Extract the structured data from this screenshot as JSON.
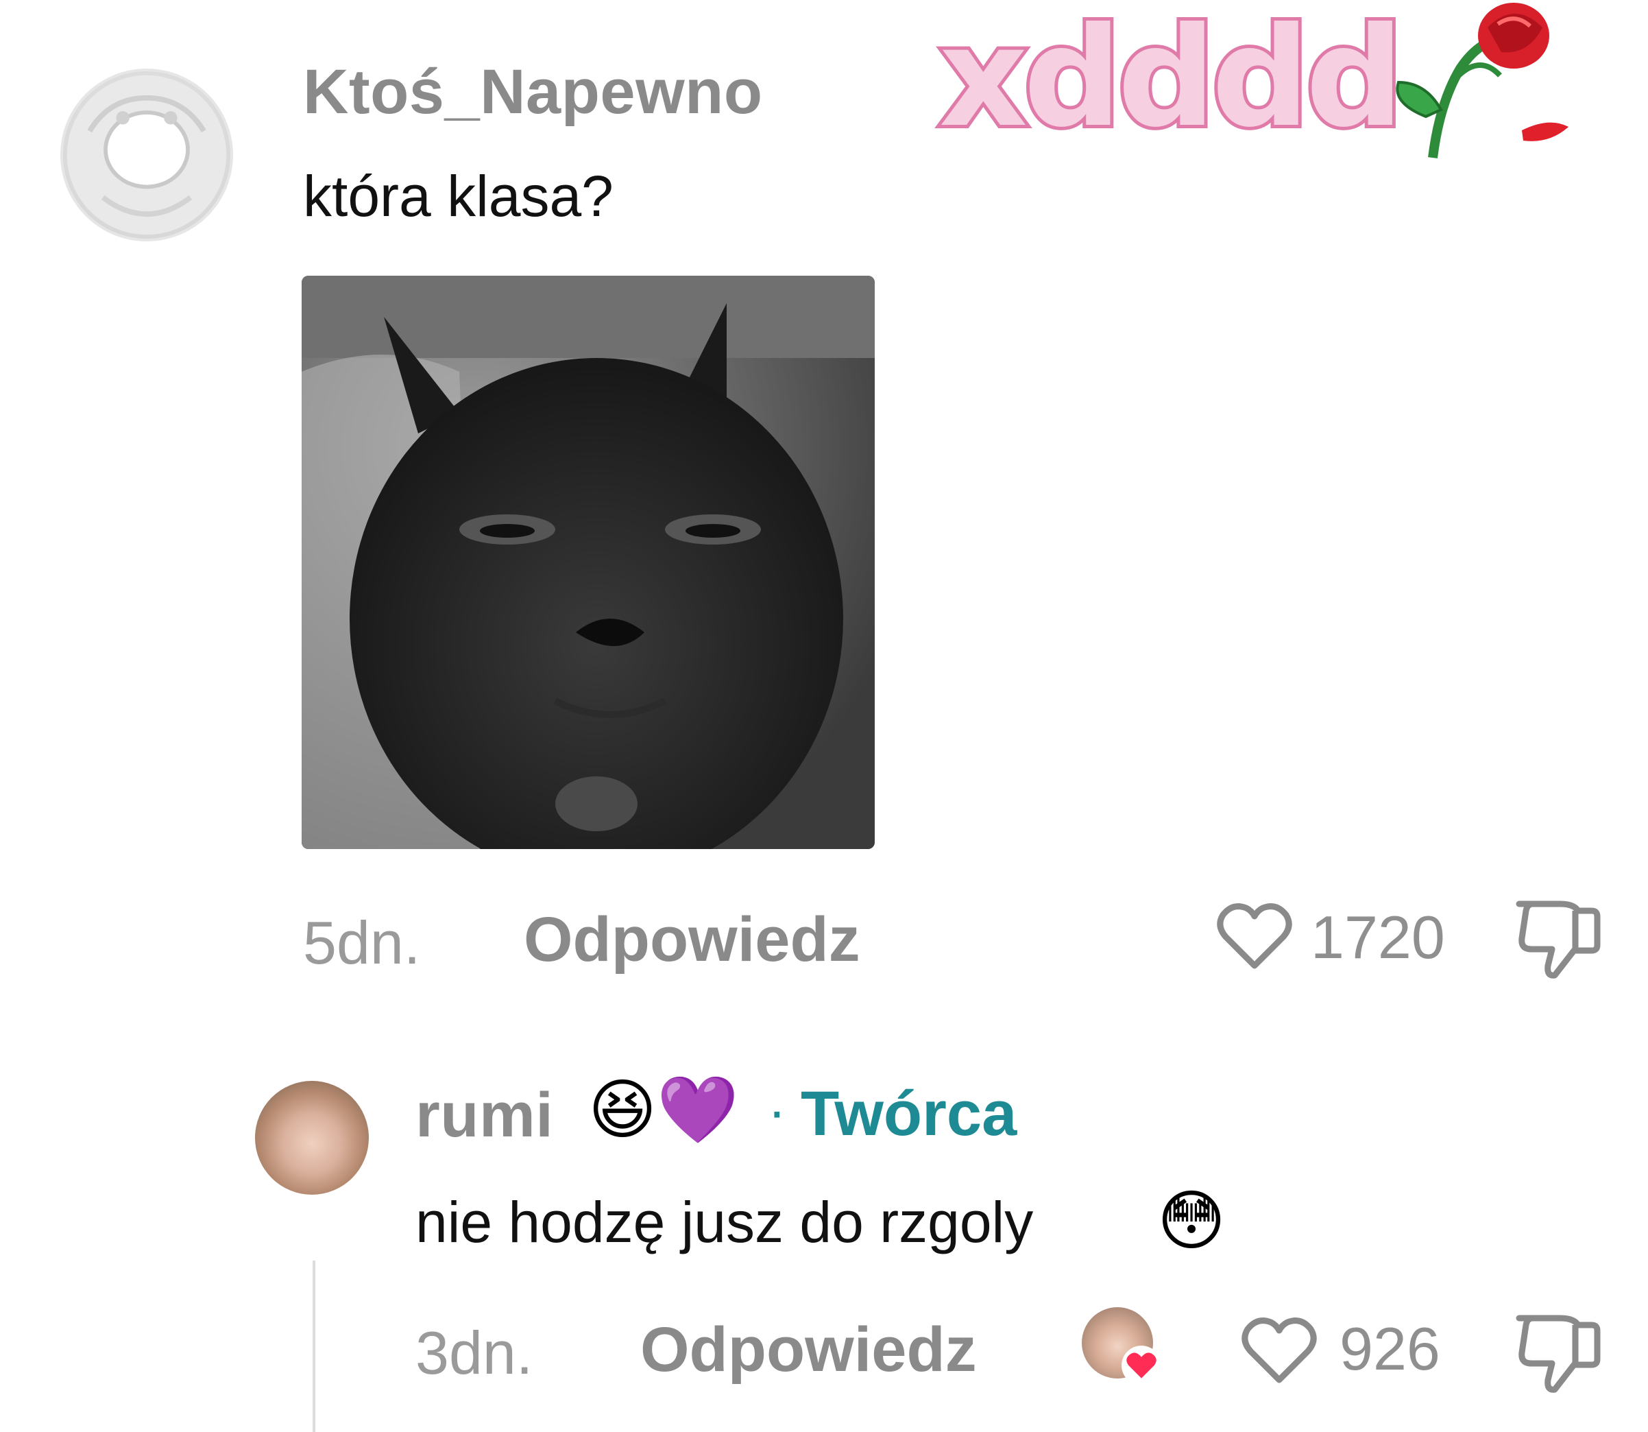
{
  "sticker": {
    "text": "xdddd",
    "rose_icon": "rose-icon"
  },
  "comment": {
    "username": "Ktoś_Napewno",
    "text": "która klasa?",
    "time": "5dn.",
    "reply_label": "Odpowiedz",
    "likes": "1720",
    "image_icon": "cat-meme-image"
  },
  "reply": {
    "username": "rumi",
    "emojis": "😆💜",
    "separator": "·",
    "creator_label": "Twórca",
    "text": "nie hodzę jusz do rzgoly",
    "text_emoji": "😳",
    "time": "3dn.",
    "reply_label": "Odpowiedz",
    "likes": "926"
  },
  "colors": {
    "creator": "#1e8a93",
    "sticker_fill": "#f6cfe1",
    "sticker_stroke": "#e07aa8",
    "heart_badge": "#ff2d55"
  }
}
